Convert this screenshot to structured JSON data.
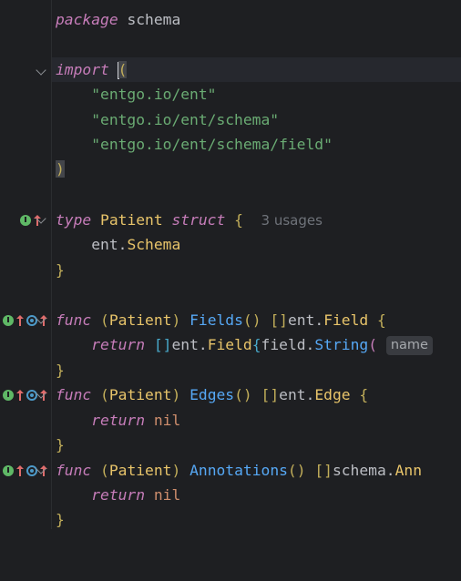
{
  "editor": {
    "lines": {
      "l1": {
        "kw": "package",
        "name": "schema"
      },
      "l3": {
        "kw": "import",
        "paren": "("
      },
      "l4": {
        "str": "\"entgo.io/ent\""
      },
      "l5": {
        "str": "\"entgo.io/ent/schema\""
      },
      "l6": {
        "str": "\"entgo.io/ent/schema/field\""
      },
      "l7": {
        "paren": ")"
      },
      "l9": {
        "kw1": "type",
        "name": "Patient",
        "kw2": "struct",
        "brace": "{",
        "usages": "3 usages"
      },
      "l10": {
        "pkg": "ent",
        "dot": ".",
        "type": "Schema"
      },
      "l11": {
        "brace": "}"
      },
      "l13": {
        "kw": "func",
        "recv_open": "(",
        "recv": "Patient",
        "recv_close": ")",
        "fn": "Fields",
        "call": "()",
        "sp": " ",
        "ret_br": "[]",
        "ret_pkg": "ent",
        "ret_type": "Field",
        "brace": "{"
      },
      "l14": {
        "kw": "return",
        "br": "[]",
        "pkg": "ent",
        "type": "Field",
        "brace": "{",
        "pkg2": "field",
        "fn": "String",
        "paren": "(",
        "hint": "name"
      },
      "l15": {
        "brace": "}"
      },
      "l16": {
        "kw": "func",
        "recv_open": "(",
        "recv": "Patient",
        "recv_close": ")",
        "fn": "Edges",
        "call": "()",
        "ret_br": "[]",
        "ret_pkg": "ent",
        "ret_type": "Edge",
        "brace": "{"
      },
      "l17": {
        "kw": "return",
        "nil": "nil"
      },
      "l18": {
        "brace": "}"
      },
      "l19": {
        "kw": "func",
        "recv_open": "(",
        "recv": "Patient",
        "recv_close": ")",
        "fn": "Annotations",
        "call": "()",
        "ret_br": "[]",
        "ret_pkg": "schema",
        "ret_type": "Ann"
      },
      "l20": {
        "kw": "return",
        "nil": "nil"
      },
      "l21": {
        "brace": "}"
      }
    }
  }
}
